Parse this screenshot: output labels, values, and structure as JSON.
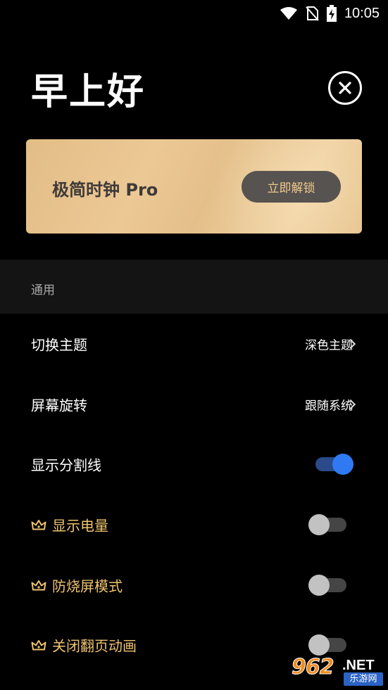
{
  "status_bar": {
    "time": "10:05",
    "icons": [
      "wifi-icon",
      "no-sim-icon",
      "battery-charging-icon"
    ]
  },
  "header": {
    "greeting": "早上好",
    "close_icon": "close-circle-icon"
  },
  "pro_card": {
    "title": "极简时钟 Pro",
    "unlock_label": "立即解锁"
  },
  "sections": [
    {
      "title": "通用",
      "items": [
        {
          "label": "切换主题",
          "value": "深色主题",
          "type": "link",
          "pro": false
        },
        {
          "label": "屏幕旋转",
          "value": "跟随系统",
          "type": "link",
          "pro": false
        },
        {
          "label": "显示分割线",
          "type": "toggle",
          "on": true,
          "pro": false
        },
        {
          "label": "显示电量",
          "type": "toggle",
          "on": false,
          "pro": true
        },
        {
          "label": "防烧屏模式",
          "type": "toggle",
          "on": false,
          "pro": true
        },
        {
          "label": "关闭翻页动画",
          "type": "toggle",
          "on": false,
          "pro": true
        }
      ]
    }
  ],
  "watermark": {
    "number": "962",
    "domain": ".NET",
    "name": "乐游网"
  },
  "colors": {
    "background": "#000000",
    "accent": "#2f7af3",
    "gold": "#efc36f",
    "card": "#e8c48f"
  }
}
